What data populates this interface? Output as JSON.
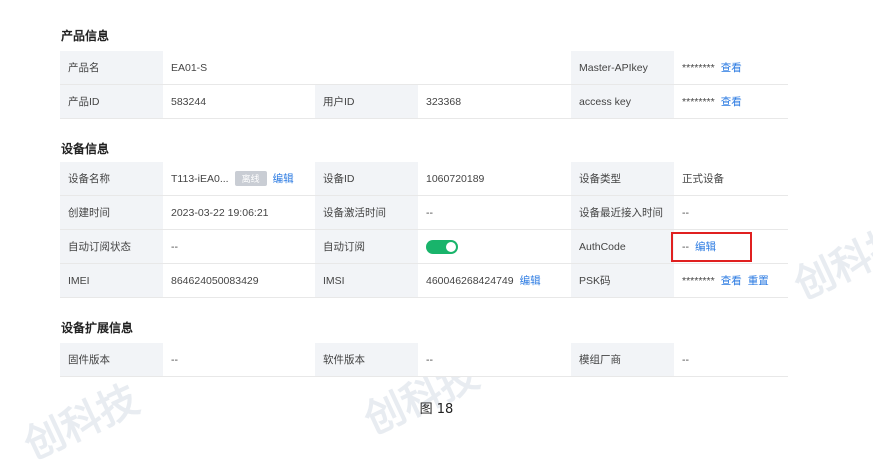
{
  "product": {
    "title": "产品信息",
    "name_label": "产品名",
    "name_value": "EA01-S",
    "master_key_label": "Master-APIkey",
    "master_key_value": "********",
    "view": "查看",
    "id_label": "产品ID",
    "id_value": "583244",
    "user_id_label": "用户ID",
    "user_id_value": "323368",
    "access_key_label": "access key",
    "access_key_value": "********"
  },
  "device": {
    "title": "设备信息",
    "name_label": "设备名称",
    "name_value": "T113-iEA0...",
    "status_badge": "离线",
    "edit": "编辑",
    "id_label": "设备ID",
    "id_value": "1060720189",
    "type_label": "设备类型",
    "type_value": "正式设备",
    "created_label": "创建时间",
    "created_value": "2023-03-22 19:06:21",
    "activated_label": "设备激活时间",
    "activated_value": "--",
    "last_access_label": "设备最近接入时间",
    "last_access_value": "--",
    "auto_sub_status_label": "自动订阅状态",
    "auto_sub_status_value": "--",
    "auto_sub_label": "自动订阅",
    "auto_sub_on": true,
    "authcode_label": "AuthCode",
    "authcode_value": "--",
    "imei_label": "IMEI",
    "imei_value": "864624050083429",
    "imsi_label": "IMSI",
    "imsi_value": "460046268424749",
    "psk_label": "PSK码",
    "psk_value": "********",
    "view": "查看",
    "reset": "重置"
  },
  "ext": {
    "title": "设备扩展信息",
    "firmware_label": "固件版本",
    "firmware_value": "--",
    "software_label": "软件版本",
    "software_value": "--",
    "module_label": "模组厂商",
    "module_value": "--"
  },
  "caption": "图 18",
  "watermark": "创科技",
  "colors": {
    "link": "#2a7ae2",
    "toggle_on": "#19b46b",
    "highlight": "#e02020"
  }
}
